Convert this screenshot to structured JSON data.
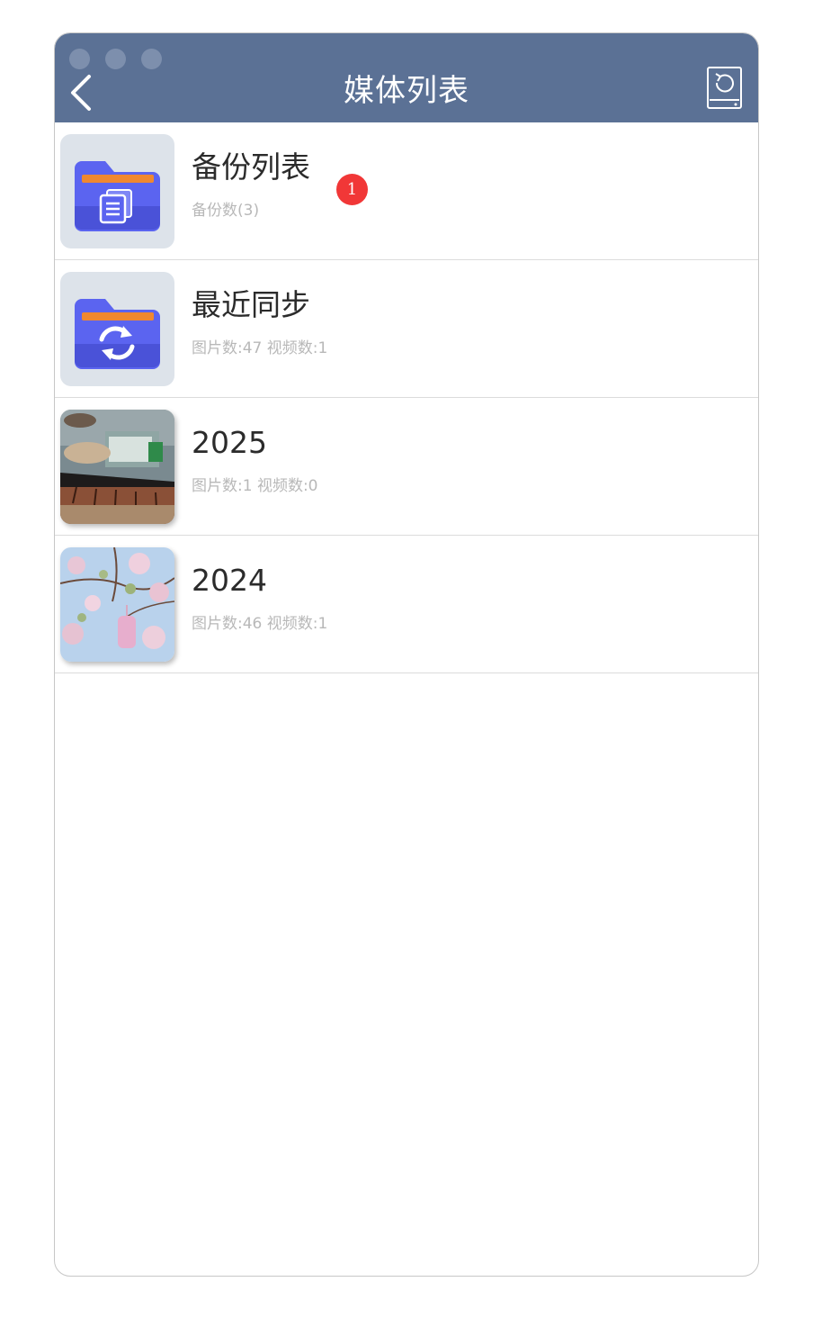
{
  "header": {
    "title": "媒体列表",
    "back_icon": "chevron-left-icon",
    "action_icon": "device-sync-icon"
  },
  "items": [
    {
      "title": "备份列表",
      "subtitle": "备份数(3)",
      "badge": "1",
      "icon": "folder-document-icon"
    },
    {
      "title": "最近同步",
      "subtitle": "图片数:47 视频数:1",
      "icon": "folder-sync-icon"
    },
    {
      "title": "2025",
      "subtitle": "图片数:1 视频数:0",
      "icon": "photo-thumbnail"
    },
    {
      "title": "2024",
      "subtitle": "图片数:46 视频数:1",
      "icon": "photo-thumbnail"
    }
  ],
  "colors": {
    "header": "#5b7195",
    "badge": "#f13737",
    "folder": "#5b64f0",
    "folder_tab": "#f0882f"
  }
}
